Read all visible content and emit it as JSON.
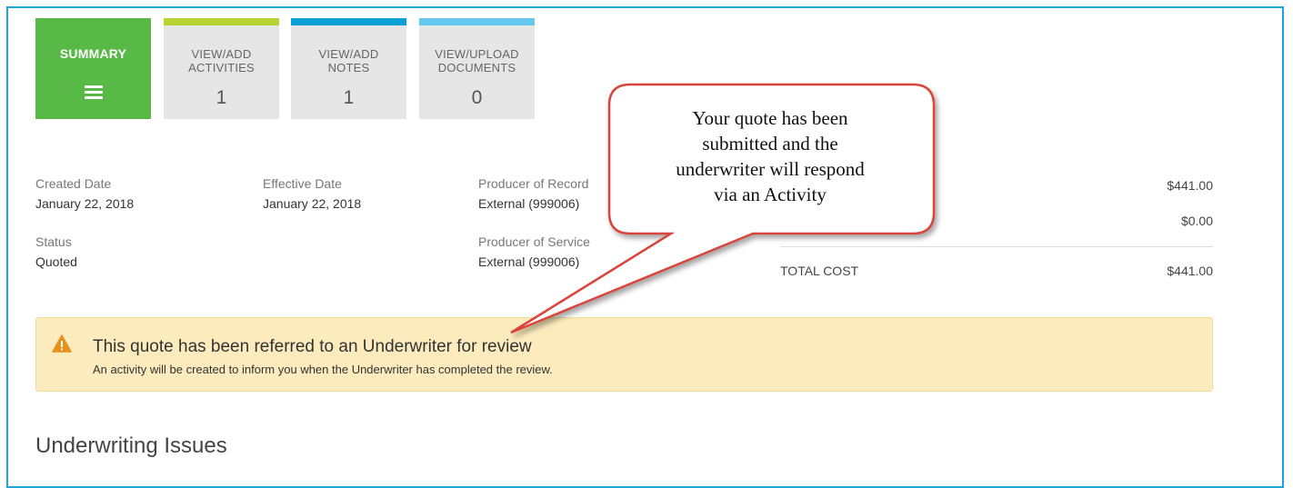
{
  "tabs": [
    {
      "label": "SUMMARY",
      "count": "",
      "color": "#58b947",
      "icon": "hamburger-icon"
    },
    {
      "label": "VIEW/ADD\nACTIVITIES",
      "count": "1",
      "color": "#b8d432"
    },
    {
      "label": "VIEW/ADD\nNOTES",
      "count": "1",
      "color": "#0b9fd8"
    },
    {
      "label": "VIEW/UPLOAD\nDOCUMENTS",
      "count": "0",
      "color": "#62c9ec"
    }
  ],
  "details": {
    "created_label": "Created Date",
    "created_value": "January 22, 2018",
    "effective_label": "Effective Date",
    "effective_value": "January 22, 2018",
    "status_label": "Status",
    "status_value": "Quoted",
    "producer_record_label": "Producer of Record",
    "producer_record_value": "External (999006)",
    "producer_service_label": "Producer of Service",
    "producer_service_value": "External (999006)"
  },
  "costs": {
    "line1_value": "$441.00",
    "line2_value": "$0.00",
    "total_label": "TOTAL COST",
    "total_value": "$441.00"
  },
  "alert": {
    "icon": "warning-icon",
    "title": "This quote has been referred to an Underwriter for review",
    "message": "An activity will be created to inform you when the Underwriter has completed the review.",
    "color": "#fcebbd"
  },
  "section": {
    "title": "Underwriting Issues"
  },
  "callout": {
    "lines": [
      "Your quote has been",
      "submitted and the",
      "underwriter will respond",
      "via an Activity"
    ],
    "border_color": "#d9443a"
  }
}
